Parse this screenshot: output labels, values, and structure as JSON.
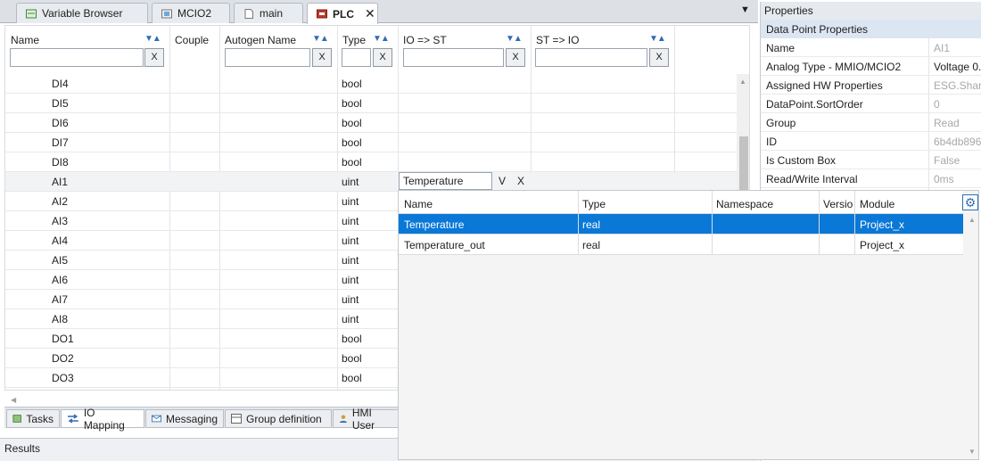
{
  "tabs": [
    {
      "label": "Variable Browser",
      "icon": "variable-browser-icon"
    },
    {
      "label": "MCIO2",
      "icon": "device-icon"
    },
    {
      "label": "main",
      "icon": "document-icon"
    },
    {
      "label": "PLC",
      "icon": "plc-icon",
      "active": true
    }
  ],
  "grid": {
    "columns": [
      {
        "label": "Name",
        "sortable": true
      },
      {
        "label": "Couple",
        "sortable": false
      },
      {
        "label": "Autogen Name",
        "sortable": true
      },
      {
        "label": "Type",
        "sortable": true
      },
      {
        "label": "IO => ST",
        "sortable": true
      },
      {
        "label": "ST => IO",
        "sortable": true
      }
    ],
    "filter_clear": "X",
    "sort_glyph": "▼▲",
    "rows": [
      {
        "name": "DI4",
        "type": "bool"
      },
      {
        "name": "DI5",
        "type": "bool"
      },
      {
        "name": "DI6",
        "type": "bool"
      },
      {
        "name": "DI7",
        "type": "bool"
      },
      {
        "name": "DI8",
        "type": "bool"
      },
      {
        "name": "AI1",
        "type": "uint"
      },
      {
        "name": "AI2",
        "type": "uint"
      },
      {
        "name": "AI3",
        "type": "uint"
      },
      {
        "name": "AI4",
        "type": "uint"
      },
      {
        "name": "AI5",
        "type": "uint"
      },
      {
        "name": "AI6",
        "type": "uint"
      },
      {
        "name": "AI7",
        "type": "uint"
      },
      {
        "name": "AI8",
        "type": "uint"
      },
      {
        "name": "DO1",
        "type": "bool"
      },
      {
        "name": "DO2",
        "type": "bool"
      },
      {
        "name": "DO3",
        "type": "bool"
      }
    ],
    "editor": {
      "value": "Temperature",
      "accept": "V",
      "cancel": "X"
    }
  },
  "popup": {
    "columns": [
      "Name",
      "Type",
      "Namespace",
      "Versio",
      "Module"
    ],
    "rows": [
      {
        "name": "Temperature",
        "type": "real",
        "namespace": "",
        "version": "",
        "module": "Project_x",
        "selected": true
      },
      {
        "name": "Temperature_out",
        "type": "real",
        "namespace": "",
        "version": "",
        "module": "Project_x",
        "selected": false
      }
    ]
  },
  "bottom_tabs": [
    {
      "label": "Tasks",
      "icon": "tasks-icon"
    },
    {
      "label": "IO Mapping",
      "icon": "io-mapping-icon",
      "active": true
    },
    {
      "label": "Messaging",
      "icon": "messaging-icon"
    },
    {
      "label": "Group definition",
      "icon": "group-icon"
    },
    {
      "label": "HMI User",
      "icon": "hmi-user-icon"
    }
  ],
  "results": {
    "title": "Results"
  },
  "properties": {
    "title": "Properties",
    "section": "Data Point Properties",
    "rows": [
      {
        "key": "Name",
        "value": "AI1",
        "dim": true
      },
      {
        "key": "Analog Type - MMIO/MCIO2",
        "value": "Voltage 0.",
        "dim": false
      },
      {
        "key": "Assigned HW Properties",
        "value": "ESG.Shark",
        "dim": true
      },
      {
        "key": "DataPoint.SortOrder",
        "value": "0",
        "dim": true
      },
      {
        "key": "Group",
        "value": "Read",
        "dim": true
      },
      {
        "key": "ID",
        "value": "6b4db896",
        "dim": true
      },
      {
        "key": "Is Custom Box",
        "value": "False",
        "dim": true
      },
      {
        "key": "Read/Write Interval",
        "value": "0ms",
        "dim": true
      }
    ]
  },
  "colors": {
    "selection": "#0a78d7",
    "accent": "#2f6db5"
  }
}
